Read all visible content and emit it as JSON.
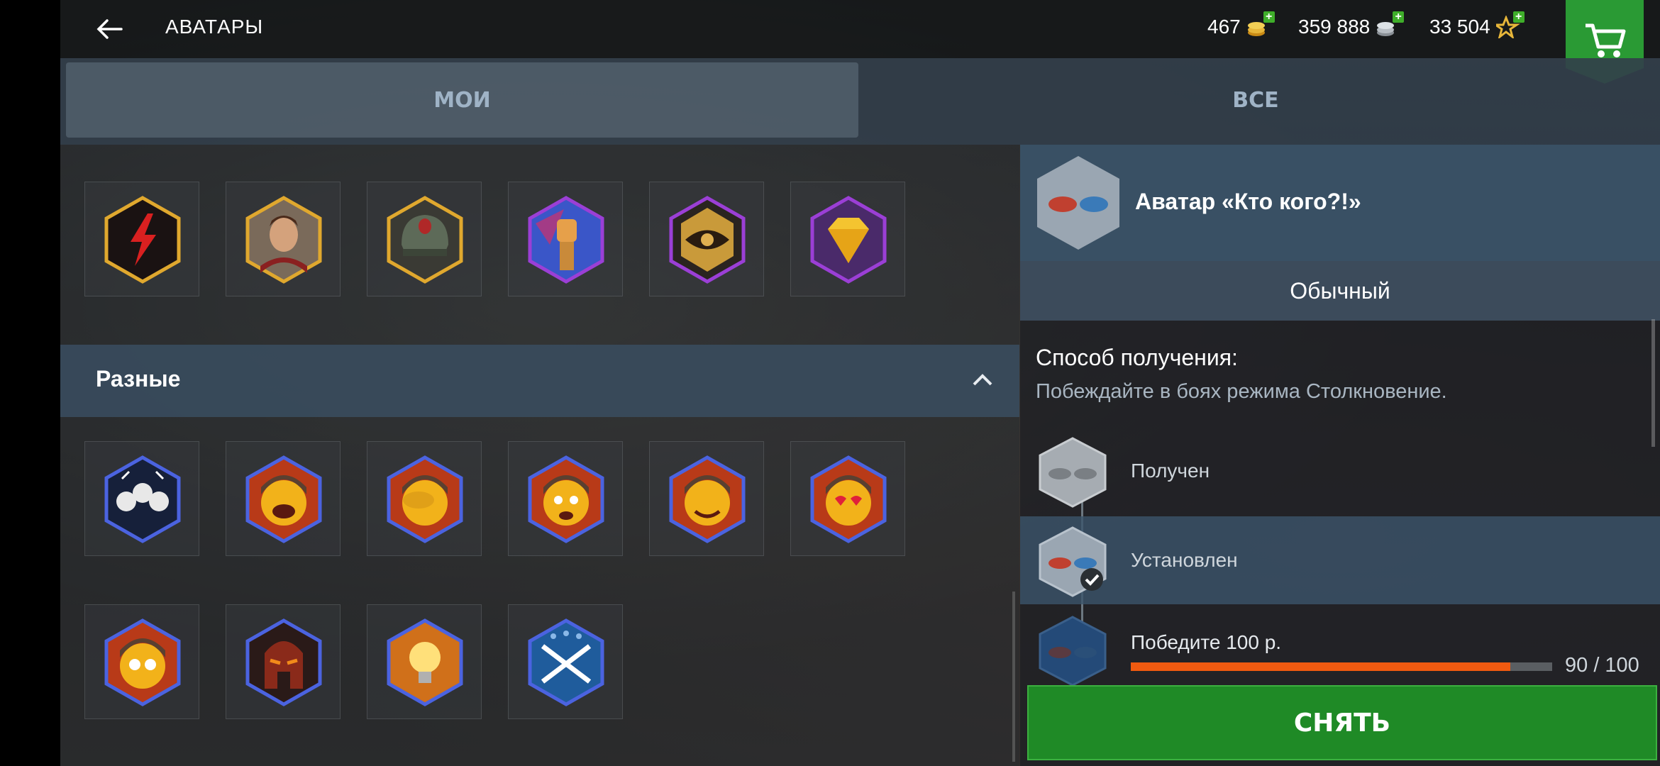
{
  "header": {
    "back_icon": "arrow-left-icon",
    "title": "АВАТАРЫ",
    "gold": "467",
    "credits": "359 888",
    "free_xp": "33 504",
    "cart_icon": "shopping-cart-icon"
  },
  "tabs": [
    {
      "label": "МОИ",
      "active": true
    },
    {
      "label": "ВСЕ",
      "active": false
    }
  ],
  "grid": {
    "top_row_icons": [
      "lightning-avatar-icon",
      "commander-portrait-icon",
      "tank-helmet-icon",
      "raised-fist-icon",
      "eye-emblem-icon",
      "diamond-icon"
    ],
    "section_title": "Разные",
    "row2_icons": [
      "team-faces-icon",
      "laughing-tanker-icon",
      "facepalm-tanker-icon",
      "shocked-tanker-icon",
      "grinning-tanker-icon",
      "heart-eyes-tanker-icon"
    ],
    "row3_icons": [
      "surprised-tanker-icon",
      "spartan-helmet-icon",
      "light-bulb-icon",
      "crossed-rifles-icon"
    ]
  },
  "detail": {
    "title": "Аватар «Кто кого?!»",
    "rarity": "Обычный",
    "method_label": "Способ получения:",
    "method_desc": "Побеждайте в боях режима Столкновение.",
    "steps": [
      "Получен",
      "Установлен",
      "Победите 100 р."
    ],
    "progress": {
      "current": 90,
      "total": 100,
      "text": "90 / 100"
    },
    "button": "СНЯТЬ"
  },
  "colors": {
    "accent_green": "#1f8a26",
    "progress_orange": "#f05a10",
    "gold_frame": "#e0a82e",
    "purple_frame": "#9b3fd6",
    "blue_frame": "#4b63e0"
  }
}
